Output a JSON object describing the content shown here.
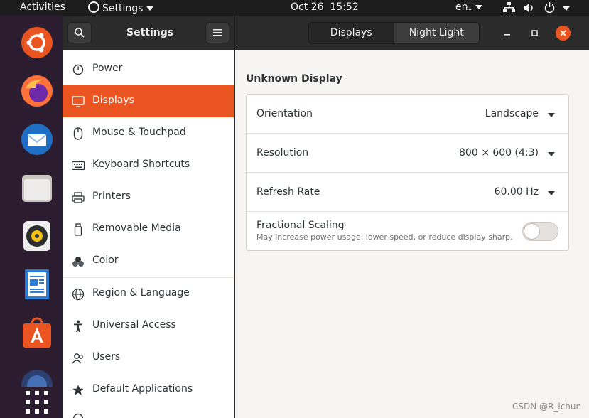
{
  "topbar": {
    "activities": "Activities",
    "app_menu": "Settings",
    "date": "Oct 26",
    "time": "15:52",
    "lang": "en₁"
  },
  "dock": {
    "items": [
      {
        "name": "ubuntu-software-icon",
        "color": "#e95420"
      },
      {
        "name": "firefox-icon",
        "color": "#ff7139"
      },
      {
        "name": "thunderbird-icon",
        "color": "#1f6fc5"
      },
      {
        "name": "files-icon",
        "color": "#e0ddd8"
      },
      {
        "name": "rhythmbox-icon",
        "color": "#f5c211"
      },
      {
        "name": "libreoffice-writer-icon",
        "color": "#2a7fd4"
      },
      {
        "name": "app-center-icon",
        "color": "#e95420"
      },
      {
        "name": "show-applications-icon",
        "color": "#ffffff"
      }
    ]
  },
  "header": {
    "title": "Settings",
    "tabs": [
      "Displays",
      "Night Light"
    ]
  },
  "sidebar": {
    "items": [
      {
        "label": "Power",
        "icon": "power-icon"
      },
      {
        "label": "Displays",
        "icon": "display-icon",
        "active": true
      },
      {
        "label": "Mouse & Touchpad",
        "icon": "mouse-icon"
      },
      {
        "label": "Keyboard Shortcuts",
        "icon": "keyboard-icon"
      },
      {
        "label": "Printers",
        "icon": "printer-icon"
      },
      {
        "label": "Removable Media",
        "icon": "removable-media-icon"
      },
      {
        "label": "Color",
        "icon": "color-icon"
      },
      {
        "label": "Region & Language",
        "icon": "globe-icon"
      },
      {
        "label": "Universal Access",
        "icon": "accessibility-icon"
      },
      {
        "label": "Users",
        "icon": "users-icon"
      },
      {
        "label": "Default Applications",
        "icon": "star-icon"
      }
    ]
  },
  "main": {
    "section_title": "Unknown Display",
    "orientation": {
      "label": "Orientation",
      "value": "Landscape"
    },
    "resolution": {
      "label": "Resolution",
      "value": "800 × 600 (4:3)"
    },
    "refresh_rate": {
      "label": "Refresh Rate",
      "value": "60.00 Hz"
    },
    "fractional_scaling": {
      "label": "Fractional Scaling",
      "description": "May increase power usage, lower speed, or reduce display sharp…",
      "enabled": false
    }
  },
  "watermark": "CSDN @R_ichun"
}
